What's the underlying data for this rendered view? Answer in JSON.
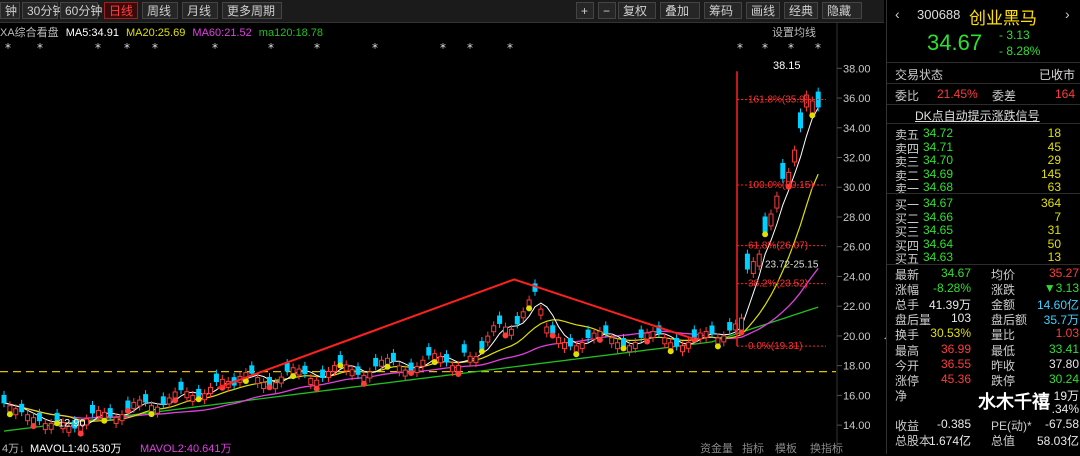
{
  "toolbar": {
    "items": [
      "钟",
      "30分钟",
      "60分钟",
      "日线",
      "周线",
      "月线",
      "更多周期",
      "+",
      "−",
      "复权",
      "叠加",
      "筹码",
      "画线",
      "经典",
      "隐藏"
    ],
    "active": "日线"
  },
  "ma_legend": {
    "title": "XA综合看盘",
    "ma5": "MA5:34.91",
    "ma20": "MA20:25.69",
    "ma60": "MA60:21.52",
    "ma120": "ma120:18.78",
    "settings": "设置均线",
    "colors": {
      "ma5": "#ffffff",
      "ma20": "#e0e000",
      "ma60": "#e040e0",
      "ma120": "#20c020"
    }
  },
  "chart_data": {
    "type": "candlestick",
    "y_ticks": [
      "38.00",
      "36.00",
      "34.00",
      "32.00",
      "30.00",
      "28.00",
      "26.00",
      "24.00",
      "22.00",
      "20.00",
      "18.00",
      "16.00",
      "14.00"
    ],
    "ylim": [
      13,
      39.5
    ],
    "fib_levels": [
      {
        "label": "161.8%(35.9)",
        "value": 35.9
      },
      {
        "label": "100.0%(30.15)",
        "value": 30.15
      },
      {
        "label": "61.8%(26.07)",
        "value": 26.07
      },
      {
        "label": "38.2%(23.52)",
        "value": 23.52
      },
      {
        "label": "0.0%(19.31)",
        "value": 19.31
      }
    ],
    "annotations": {
      "high": "38.15",
      "low": "12.90",
      "mid": "23.72-25.15"
    },
    "dashed_level": 17.6,
    "red_line_points": [
      [
        0.26,
        16.5
      ],
      [
        0.615,
        23.8
      ],
      [
        0.83,
        19.8
      ]
    ],
    "colors": {
      "up": "#ff3b3b",
      "down": "#00d0ff",
      "fib": "#ff2020"
    }
  },
  "bottom_bar": {
    "volume_label": "4万↓",
    "mavol1": "MAVOL1:40.530万",
    "mavol2": "MAVOL2:40.641万",
    "tabs": [
      "资金量",
      "指标",
      "模板",
      "换指标"
    ]
  },
  "stock": {
    "code": "300688",
    "name": "创业黑马",
    "price": "34.67",
    "change": "- 3.13",
    "change_pct": "- 8.28%",
    "status_label": "交易状态",
    "status": "已收市",
    "weibi_label": "委比",
    "weibi": "21.45%",
    "weicha_label": "委差",
    "weicha": "164",
    "dk_label": "DK点自动提示涨跌信号"
  },
  "sells": [
    {
      "label": "卖五",
      "price": "34.72",
      "vol": "18"
    },
    {
      "label": "卖四",
      "price": "34.71",
      "vol": "45"
    },
    {
      "label": "卖三",
      "price": "34.70",
      "vol": "29"
    },
    {
      "label": "卖二",
      "price": "34.69",
      "vol": "145"
    },
    {
      "label": "卖一",
      "price": "34.68",
      "vol": "63"
    }
  ],
  "buys": [
    {
      "label": "买一",
      "price": "34.67",
      "vol": "364"
    },
    {
      "label": "买二",
      "price": "34.66",
      "vol": "7"
    },
    {
      "label": "买三",
      "price": "34.65",
      "vol": "31"
    },
    {
      "label": "买四",
      "price": "34.64",
      "vol": "50"
    },
    {
      "label": "买五",
      "price": "34.63",
      "vol": "13"
    }
  ],
  "stats": [
    {
      "l1": "最新",
      "v1": "34.67",
      "c1": "green",
      "l2": "均价",
      "v2": "35.27",
      "c2": "red"
    },
    {
      "l1": "涨幅",
      "v1": "-8.28%",
      "c1": "green",
      "l2": "涨跌",
      "v2": "▼3.13",
      "c2": "green"
    },
    {
      "l1": "总手",
      "v1": "41.39万",
      "c1": "white",
      "l2": "金额",
      "v2": "14.60亿",
      "c2": "cyan"
    },
    {
      "l1": "盘后量",
      "v1": "103",
      "c1": "white",
      "l2": "盘后额",
      "v2": "35.7万",
      "c2": "cyan"
    },
    {
      "l1": "换手",
      "v1": "30.53%",
      "c1": "yellow",
      "l2": "量比",
      "v2": "1.03",
      "c2": "red"
    },
    {
      "l1": "最高",
      "v1": "36.99",
      "c1": "red",
      "l2": "最低",
      "v2": "33.41",
      "c2": "green"
    },
    {
      "l1": "今开",
      "v1": "36.55",
      "c1": "red",
      "l2": "昨收",
      "v2": "37.80",
      "c2": "white"
    },
    {
      "l1": "涨停",
      "v1": "45.36",
      "c1": "red",
      "l2": "跌停",
      "v2": "30.24",
      "c2": "green"
    },
    {
      "l1": "净",
      "v1": "",
      "c1": "white",
      "l2": "",
      "v2": "19万",
      "c2": "white"
    },
    {
      "l1": "",
      "v1": "",
      "c1": "white",
      "l2": "",
      "v2": ".34%",
      "c2": "white"
    },
    {
      "l1": "收益",
      "v1": "-0.385",
      "c1": "white",
      "l2": "PE(动)*",
      "v2": "-67.58",
      "c2": "white"
    },
    {
      "l1": "总股本",
      "v1": "1.674亿",
      "c1": "white",
      "l2": "总值",
      "v2": "58.03亿",
      "c2": "white"
    }
  ],
  "watermark": "水木千禧"
}
